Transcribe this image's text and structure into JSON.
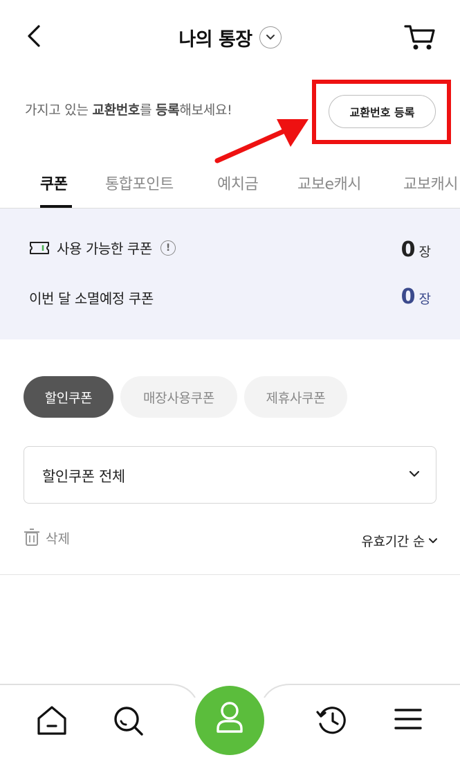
{
  "header": {
    "title": "나의 통장",
    "back_icon": "chevron-left-icon",
    "cart_icon": "cart-icon"
  },
  "exchange": {
    "text_prefix": "가지고 있는 ",
    "text_bold1": "교환번호",
    "text_mid": "를 ",
    "text_bold2": "등록",
    "text_suffix": "해보세요!",
    "button_label": "교환번호 등록"
  },
  "tabs": [
    "쿠폰",
    "통합포인트",
    "예치금",
    "교보e캐시",
    "교보캐시"
  ],
  "summary": {
    "available_label": "사용 가능한 쿠폰",
    "available_count": "0",
    "available_unit": "장",
    "expiring_label": "이번 달 소멸예정 쿠폰",
    "expiring_count": "0",
    "expiring_unit": "장",
    "expiring_color": "#3b4a8c"
  },
  "chips": {
    "discount": "할인쿠폰",
    "store": "매장사용쿠폰",
    "partner": "제휴사쿠폰"
  },
  "select": {
    "value": "할인쿠폰 전체"
  },
  "actions": {
    "delete_label": "삭제",
    "sort_label": "유효기간 순"
  },
  "colors": {
    "accent_green": "#5bbd3c",
    "highlight_red": "#ee1111"
  }
}
